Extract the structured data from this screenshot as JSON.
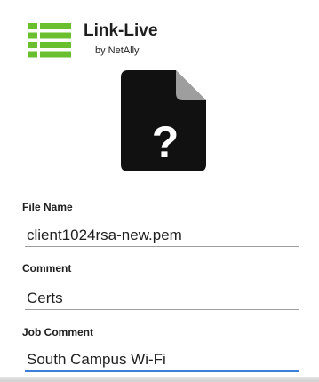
{
  "app": {
    "title": "Link-Live",
    "subtitle": "by NetAlly"
  },
  "colors": {
    "brand_green": "#6abf2e",
    "file_icon": "#111111",
    "file_icon_fold": "#9e9e9e",
    "focus_underline": "#3b7fd6"
  },
  "icons": {
    "logo": "link-live-logo-icon",
    "file": "unknown-file-icon"
  },
  "file_icon_glyph": "?",
  "form": {
    "file_name": {
      "label": "File Name",
      "value": "client1024rsa-new.pem"
    },
    "comment": {
      "label": "Comment",
      "value": "Certs"
    },
    "job_comment": {
      "label": "Job Comment",
      "value": "South Campus Wi-Fi"
    }
  }
}
